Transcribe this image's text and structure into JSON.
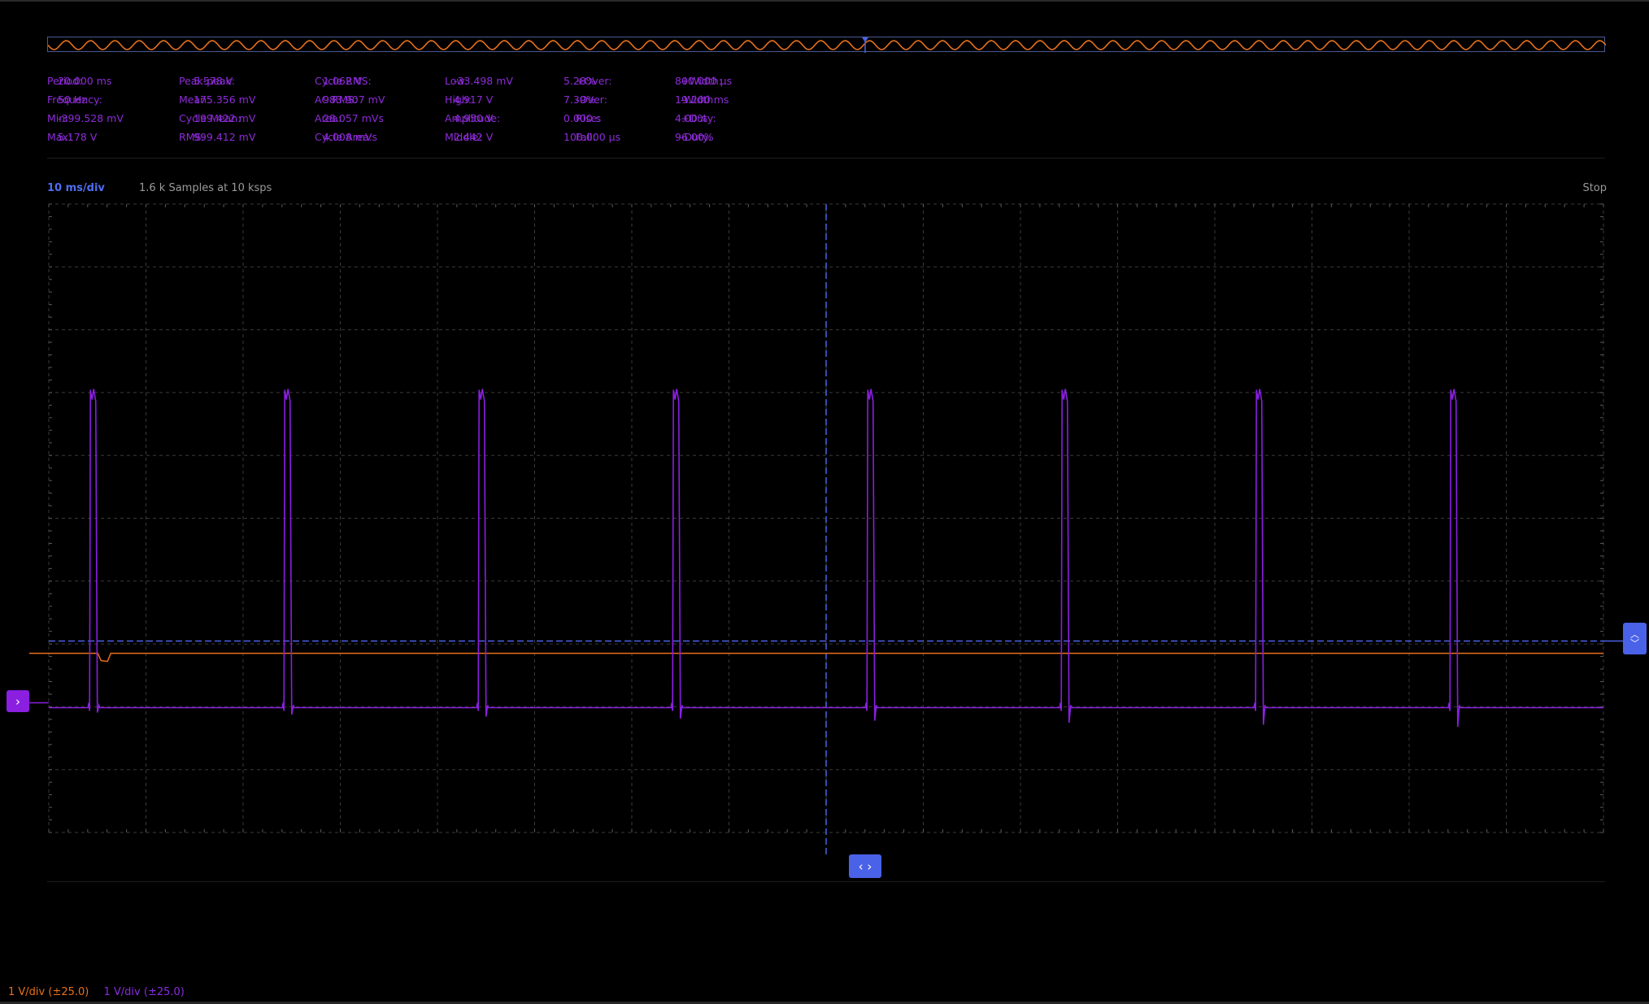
{
  "measurements": [
    [
      {
        "label": "Period:",
        "value": "20.000 ms"
      },
      {
        "label": "Frequency:",
        "value": "50 Hz"
      },
      {
        "label": "Min:",
        "value": "-399.528 mV"
      },
      {
        "label": "Max:",
        "value": "5.178 V"
      }
    ],
    [
      {
        "label": "Peak-peak:",
        "value": "5.578 V"
      },
      {
        "label": "Mean:",
        "value": "175.356 mV"
      },
      {
        "label": "Cycle Mean:",
        "value": "199.422 mV"
      },
      {
        "label": "RMS:",
        "value": "999.412 mV"
      }
    ],
    [
      {
        "label": "Cycle RMS:",
        "value": "1.062 V"
      },
      {
        "label": "AC RMS:",
        "value": "983.907 mV"
      },
      {
        "label": "Area:",
        "value": "28.057 mVs"
      },
      {
        "label": "Cycle Area:",
        "value": "4.008 mVs"
      }
    ],
    [
      {
        "label": "Low:",
        "value": "-33.498 mV"
      },
      {
        "label": "High:",
        "value": "4.917 V"
      },
      {
        "label": "Amplitude:",
        "value": "4.950 V"
      },
      {
        "label": "Middle:",
        "value": "2.442 V"
      }
    ],
    [
      {
        "label": "+Over:",
        "value": "5.28%"
      },
      {
        "label": "-Over:",
        "value": "7.39%"
      },
      {
        "label": "Rise:",
        "value": "0.000 s"
      },
      {
        "label": "Fall:",
        "value": "100.000 µs"
      }
    ],
    [
      {
        "label": "+Width:",
        "value": "800.000 µs"
      },
      {
        "label": "-Width:",
        "value": "19.200 ms"
      },
      {
        "label": "+Duty:",
        "value": "4.00%"
      },
      {
        "label": "-Duty:",
        "value": "96.00%"
      }
    ]
  ],
  "timebase": {
    "label": "10 ms/div",
    "samples": "1.6 k Samples at 10 ksps",
    "run_state": "Stop"
  },
  "channels": [
    {
      "status": "1 V/div (±25.0)",
      "color": "#e8701a"
    },
    {
      "status": "1 V/div (±25.0)",
      "color": "#8a2be2"
    }
  ],
  "colors": {
    "accent": "#4a62e8",
    "channel_purple": "#8a1fe0",
    "channel_orange": "#e8701a",
    "grid": "#3a3a3a"
  },
  "icons": {
    "channel_handle": "chevron-right-icon",
    "trigger_handle": "chevron-up-down-icon",
    "time_handle": "chevron-left-right-icon"
  },
  "chart_data": {
    "type": "line",
    "x_per_div_ms": 10,
    "divisions_x": 16,
    "divisions_y": 10,
    "volts_per_div": 1,
    "series": [
      {
        "period_ms": 20,
        "low_V": -0.033,
        "high_V": 4.917,
        "pulse_width_ms": 0.8,
        "pulse_starts_ms": [
          4.2,
          24.2,
          44.2,
          64.2,
          84.2,
          104.2,
          124.2,
          144.2
        ]
      },
      {
        "level_V": 0.85
      }
    ],
    "trigger_level_V": 1.05
  }
}
